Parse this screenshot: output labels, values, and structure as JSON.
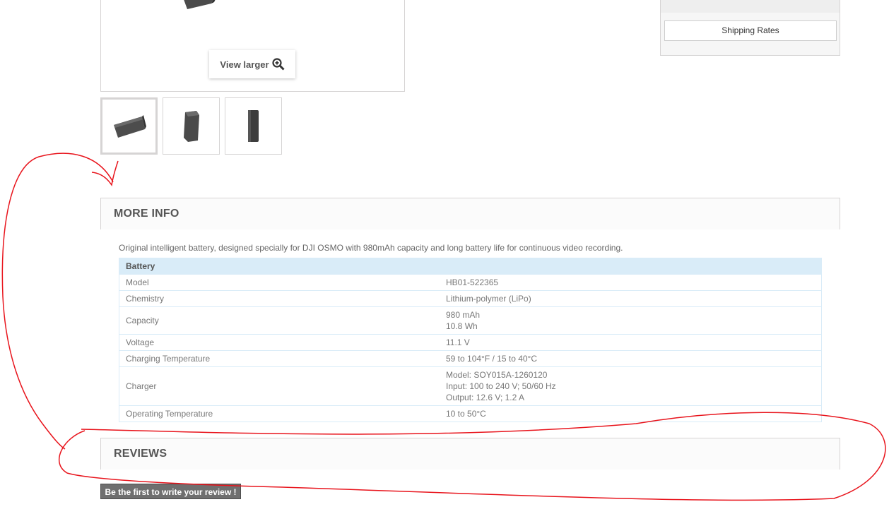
{
  "gallery": {
    "view_larger_label": "View larger",
    "thumbnails": [
      "thumbnail-1",
      "thumbnail-2",
      "thumbnail-3"
    ]
  },
  "sidebar": {
    "shipping_rates_label": "Shipping Rates"
  },
  "more_info": {
    "title": "MORE INFO",
    "description": "Original intelligent battery, designed specially for DJI OSMO with 980mAh capacity and long battery life for continuous video recording.",
    "table_header": "Battery",
    "rows": [
      {
        "label": "Model",
        "value": [
          "HB01-522365"
        ]
      },
      {
        "label": "Chemistry",
        "value": [
          "Lithium-polymer (LiPo)"
        ]
      },
      {
        "label": "Capacity",
        "value": [
          "980 mAh",
          "10.8 Wh"
        ]
      },
      {
        "label": "Voltage",
        "value": [
          "11.1 V"
        ]
      },
      {
        "label": "Charging Temperature",
        "value": [
          "59 to 104°F / 15 to 40°C"
        ]
      },
      {
        "label": "Charger",
        "value": [
          "Model: SOY015A-1260120",
          "Input: 100 to 240 V; 50/60 Hz",
          "Output: 12.6 V; 1.2 A"
        ]
      },
      {
        "label": "Operating Temperature",
        "value": [
          "10 to 50°C"
        ]
      }
    ]
  },
  "reviews": {
    "title": "REVIEWS",
    "write_review_label": "Be the first to write your review !"
  },
  "colors": {
    "annotation": "#e8141c",
    "table_header_bg": "#d9ecf8",
    "button_bg": "#6f6f6f"
  }
}
